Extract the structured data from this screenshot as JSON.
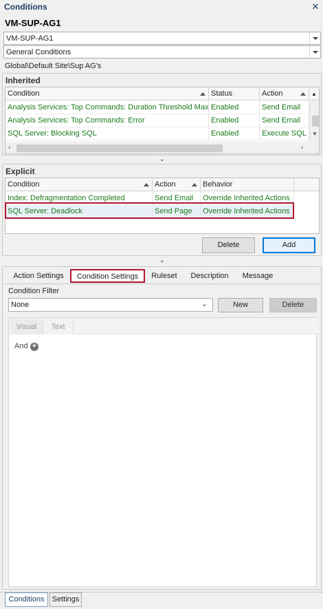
{
  "panel": {
    "title": "Conditions",
    "close_icon": "close-icon"
  },
  "server": {
    "name": "VM-SUP-AG1"
  },
  "server_combo": {
    "value": "VM-SUP-AG1"
  },
  "type_combo": {
    "value": "General Conditions"
  },
  "path": "Global\\Default Site\\Sup AG's",
  "inherited": {
    "title": "Inherited",
    "columns": [
      "Condition",
      "Status",
      "Action"
    ],
    "rows": [
      [
        "Analysis Services: Top Commands: Duration Threshold Max",
        "Enabled",
        "Send Email"
      ],
      [
        "Analysis Services: Top Commands: Error",
        "Enabled",
        "Send Email"
      ],
      [
        "SQL Server: Blocking SQL",
        "Enabled",
        "Execute SQL"
      ]
    ]
  },
  "explicit": {
    "title": "Explicit",
    "columns": [
      "Condition",
      "Action",
      "Behavior"
    ],
    "rows": [
      [
        "Index: Defragmentation Completed",
        "Send Email",
        "Override Inherited Actions"
      ],
      [
        "SQL Server: Deadlock",
        "Send Page",
        "Override Inherited Actions"
      ]
    ],
    "delete_label": "Delete",
    "add_label": "Add"
  },
  "settings_tabs": [
    "Action Settings",
    "Condition Settings",
    "Ruleset",
    "Description",
    "Message"
  ],
  "active_settings_tab": "Condition Settings",
  "condition_filter": {
    "label": "Condition Filter",
    "value": "None",
    "new_label": "New",
    "delete_label": "Delete"
  },
  "editor_tabs": [
    "Visual",
    "Text"
  ],
  "rule": {
    "and_label": "And"
  },
  "bottom_tabs": [
    "Conditions",
    "Settings"
  ],
  "colors": {
    "title_blue": "#1e3f66",
    "enabled_green": "#1a7a1a",
    "highlight_red": "#b0152d",
    "primary_blue": "#0078d7"
  }
}
